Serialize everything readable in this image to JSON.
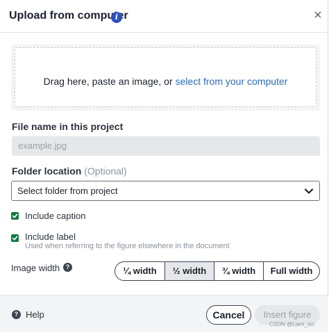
{
  "dialog": {
    "title": "Upload from computer",
    "info_icon_glyph": "i",
    "close_glyph": "×"
  },
  "dropzone": {
    "text": "Drag here, paste an image, or ",
    "link": "select from your computer"
  },
  "file_name": {
    "label": "File name in this project",
    "placeholder": "example.jpg"
  },
  "folder": {
    "label": "Folder location",
    "optional": "(Optional)",
    "selected": "Select folder from project"
  },
  "caption": {
    "label": "Include caption",
    "checked": true
  },
  "label_opt": {
    "label": "Include label",
    "helper": "Used when referring to the figure elsewhere in the document",
    "checked": true
  },
  "image_width": {
    "label": "Image width",
    "options": [
      "¼ width",
      "½ width",
      "¾ width",
      "Full width"
    ],
    "selected": "½ width"
  },
  "footer": {
    "help": "Help",
    "cancel": "Cancel",
    "insert": "Insert figure"
  },
  "watermark": "CSDN @Liam_xin",
  "colors": {
    "accent_link": "#2b6db8",
    "info_icon": "#2d4fbf",
    "checkbox": "#0f7b3d"
  }
}
